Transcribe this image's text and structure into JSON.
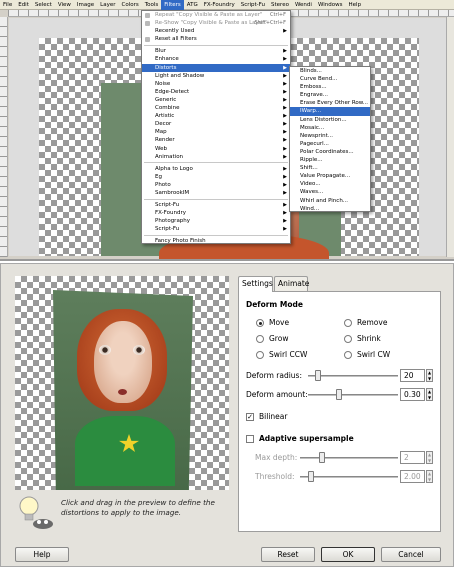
{
  "menubar": {
    "items": [
      "File",
      "Edit",
      "Select",
      "View",
      "Image",
      "Layer",
      "Colors",
      "Tools",
      "Filters",
      "ATG",
      "FX-Foundry",
      "Script-Fu",
      "Stereo",
      "Wendi",
      "Windows",
      "Help"
    ]
  },
  "filters_menu": {
    "repeat": "Repeat \"Copy Visible & Paste as Layer\"",
    "repeat_accel": "Ctrl+F",
    "reshow": "Re-Show \"Copy Visible & Paste as Layer\"",
    "reshow_accel": "Shift+Ctrl+F",
    "recently_used": "Recently Used",
    "reset_all": "Reset all Filters",
    "group1": [
      "Blur",
      "Enhance",
      "Distorts",
      "Light and Shadow",
      "Noise",
      "Edge-Detect",
      "Generic",
      "Combine",
      "Artistic",
      "Decor",
      "Map",
      "Render",
      "Web",
      "Animation"
    ],
    "group2": [
      "Alpha to Logo",
      "Eg",
      "Photo",
      "SambrookIM"
    ],
    "group3": [
      "Script-Fu",
      "FX-Foundry",
      "Photography",
      "Script-Fu"
    ],
    "last": "Fancy Photo Finish"
  },
  "distorts_menu": {
    "items": [
      "Blinds...",
      "Curve Bend...",
      "Emboss...",
      "Engrave...",
      "Erase Every Other Row...",
      "IWarp...",
      "Lens Distortion...",
      "Mosaic...",
      "Newsprint...",
      "Pagecurl...",
      "Polar Coordinates...",
      "Ripple...",
      "Shift...",
      "Value Propagate...",
      "Video...",
      "Waves...",
      "Whirl and Pinch...",
      "Wind..."
    ],
    "highlighted_index": 5
  },
  "dialog": {
    "tabs": [
      "Settings",
      "Animate"
    ],
    "deform_mode_label": "Deform Mode",
    "modes": [
      "Move",
      "Remove",
      "Grow",
      "Shrink",
      "Swirl CCW",
      "Swirl CW"
    ],
    "selected_mode": "Move",
    "deform_radius_label": "Deform radius:",
    "deform_radius_value": "20",
    "deform_amount_label": "Deform amount:",
    "deform_amount_value": "0.30",
    "bilinear_label": "Bilinear",
    "bilinear_checked": true,
    "adaptive_label": "Adaptive supersample",
    "adaptive_checked": false,
    "max_depth_label": "Max depth:",
    "max_depth_value": "2",
    "threshold_label": "Threshold:",
    "threshold_value": "2.00",
    "hint": "Click and drag in the preview to define the distortions to apply to the image.",
    "help_button": "Help",
    "reset_button": "Reset",
    "ok_button": "OK",
    "cancel_button": "Cancel"
  },
  "colors": {
    "highlight": "#316ac5",
    "menubar": "#ece9d8",
    "dialog_bg": "#e4e2dc"
  }
}
